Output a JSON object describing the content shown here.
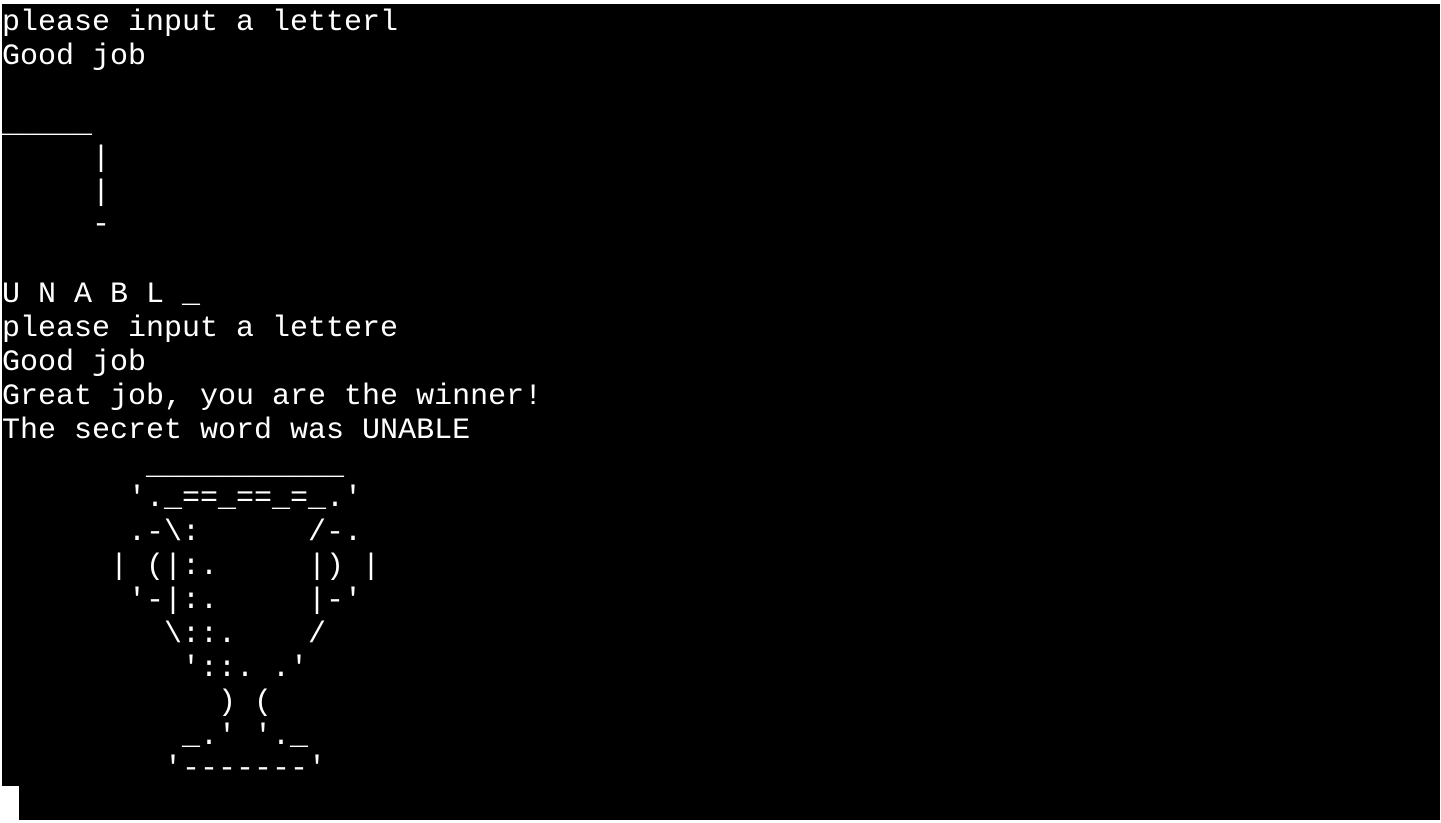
{
  "terminal": {
    "background": "#000000",
    "foreground": "#ffffff",
    "prompt_1": "please input a letterl",
    "feedback_1": "Good job",
    "hangman_art": [
      "_____",
      "     |",
      "     |",
      "     -"
    ],
    "word_progress": "U N A B L _",
    "prompt_2": "please input a lettere",
    "feedback_2": "Good job",
    "win_message": "Great job, you are the winner!",
    "secret_word_message": "The secret word was UNABLE",
    "trophy_art": [
      "        ___________",
      "       '._==_==_=_.'",
      "       .-\\:      /-.",
      "      | (|:.     |) |",
      "       '-|:.     |-'",
      "         \\::.    /",
      "          '::. .'",
      "            ) (",
      "          _.' '._",
      "         '-------'"
    ]
  }
}
